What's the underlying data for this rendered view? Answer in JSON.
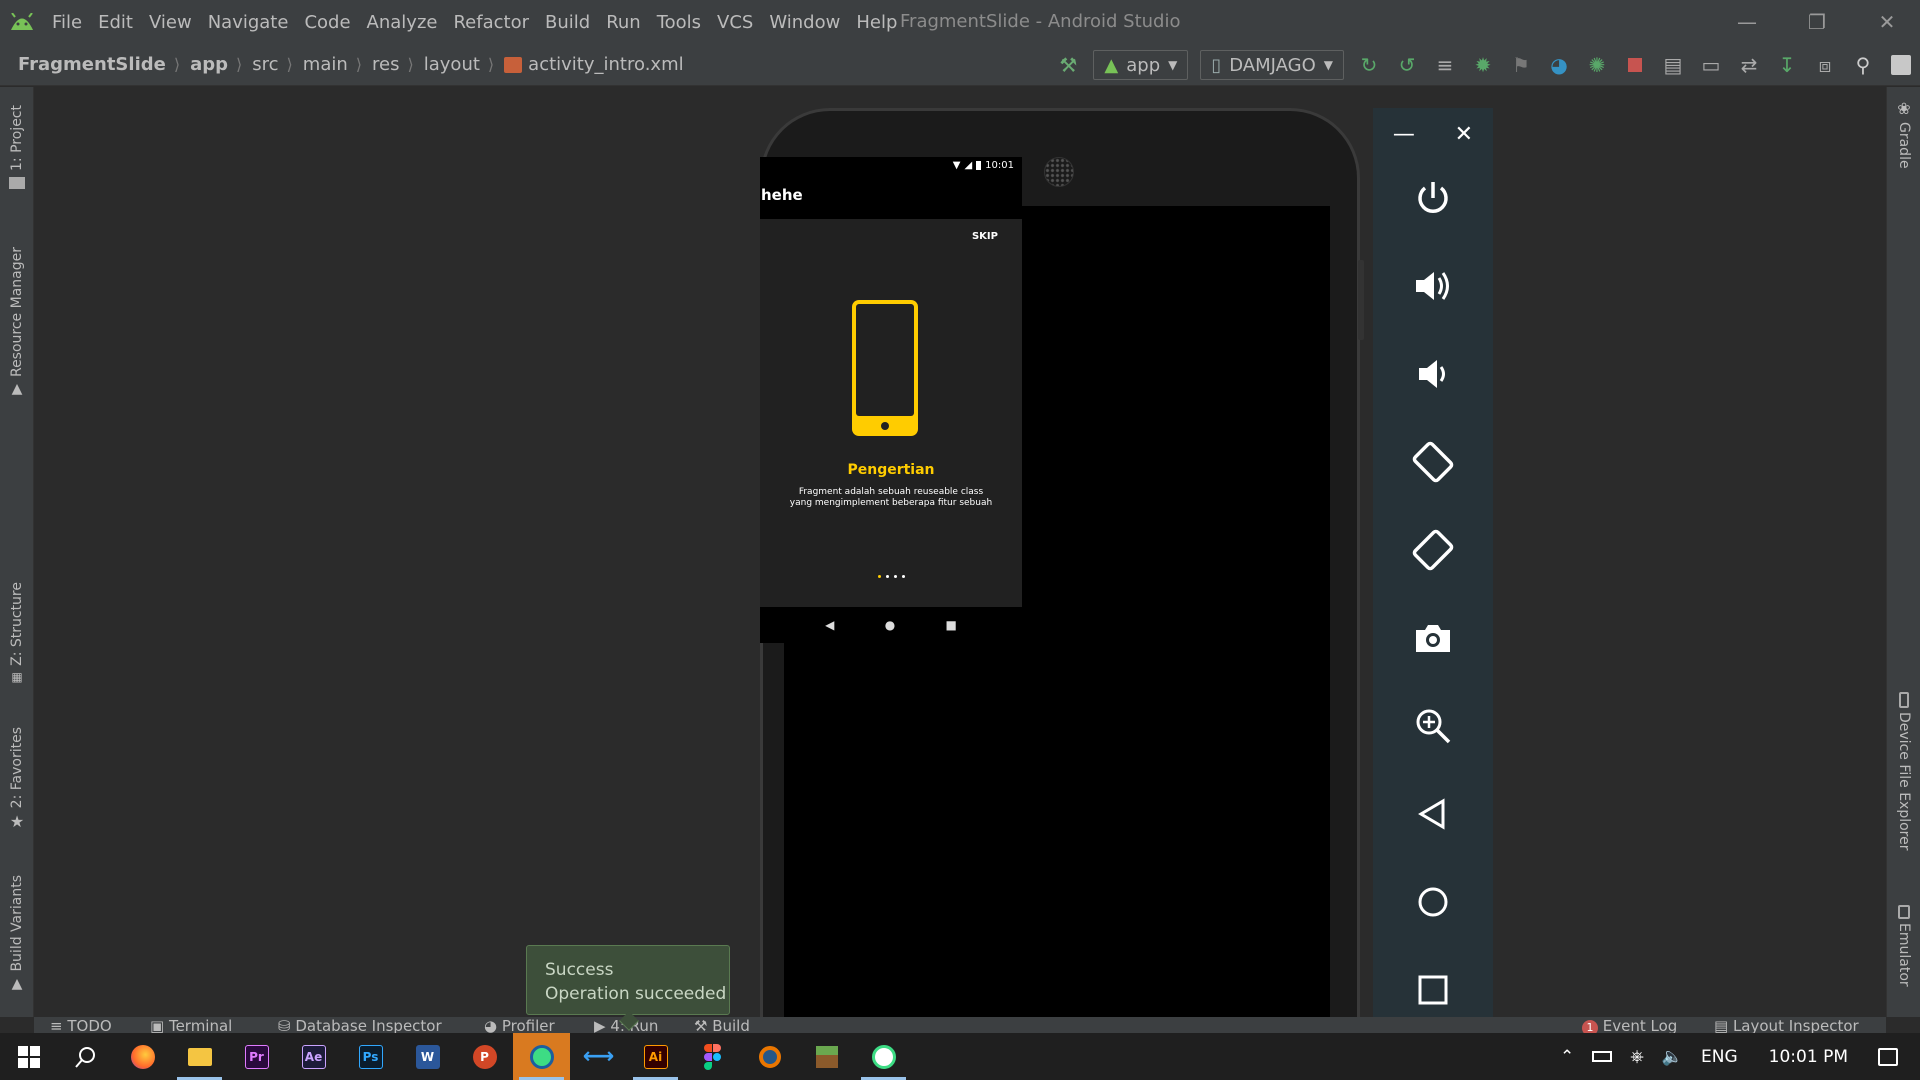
{
  "menubar": {
    "items": [
      "File",
      "Edit",
      "View",
      "Navigate",
      "Code",
      "Analyze",
      "Refactor",
      "Build",
      "Run",
      "Tools",
      "VCS",
      "Window",
      "Help"
    ],
    "window_title": "FragmentSlide - Android Studio"
  },
  "breadcrumb": {
    "project": "FragmentSlide",
    "module": "app",
    "src": "src",
    "main": "main",
    "res": "res",
    "layout": "layout",
    "file": "activity_intro.xml"
  },
  "toolbar": {
    "run_config": "app",
    "device": "DAMJAGO"
  },
  "left_tabs": {
    "project": "1: Project",
    "resource_manager": "Resource Manager",
    "structure": "Z: Structure",
    "favorites": "2: Favorites",
    "build_variants": "Build Variants"
  },
  "right_tabs": {
    "gradle": "Gradle",
    "device_file_explorer": "Device File Explorer",
    "emulator": "Emulator"
  },
  "bottom_tabs": {
    "todo": "TODO",
    "terminal": "Terminal",
    "database_inspector": "Database Inspector",
    "profiler": "Profiler",
    "run": "4: Run",
    "build": "Build",
    "event_log": "Event Log",
    "layout_inspector": "Layout Inspector",
    "event_log_count": "1"
  },
  "phone": {
    "time": "10:01",
    "app_title": "hehe",
    "skip_label": "SKIP",
    "slide_title": "Pengertian",
    "slide_desc_line1": "Fragment adalah sebuah reuseable class",
    "slide_desc_line2": "yang mengimplement beberapa fitur sebuah",
    "page_count": 4,
    "active_page": 1
  },
  "toast": {
    "title": "Success",
    "message": "Operation succeeded"
  },
  "taskbar": {
    "language": "ENG",
    "time": "10:01 PM"
  },
  "colors": {
    "accent_yellow": "#ffcc00",
    "ide_bg": "#2b2b2b",
    "panel_bg": "#3c3f41",
    "emulator_panel": "#263238"
  }
}
